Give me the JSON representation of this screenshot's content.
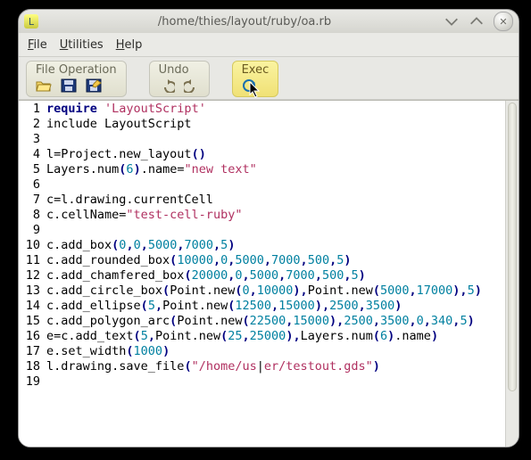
{
  "window": {
    "title": "/home/thies/layout/ruby/oa.rb"
  },
  "menu": {
    "file": "File",
    "utilities": "Utilities",
    "help": "Help"
  },
  "toolbar": {
    "fileop_label": "File Operation",
    "undo_label": "Undo",
    "exec_label": "Exec"
  },
  "code": {
    "lines": [
      {
        "n": "1",
        "segs": [
          {
            "t": "require ",
            "c": "kw"
          },
          {
            "t": "'LayoutScript'",
            "c": "str"
          }
        ]
      },
      {
        "n": "2",
        "segs": [
          {
            "t": "include LayoutScript",
            "c": "inc"
          }
        ]
      },
      {
        "n": "3",
        "segs": []
      },
      {
        "n": "4",
        "segs": [
          {
            "t": "l=Project.new_layout",
            "c": ""
          },
          {
            "t": "()",
            "c": "kw"
          }
        ]
      },
      {
        "n": "5",
        "segs": [
          {
            "t": "Layers.num",
            "c": ""
          },
          {
            "t": "(",
            "c": "kw"
          },
          {
            "t": "6",
            "c": "num"
          },
          {
            "t": ")",
            "c": "kw"
          },
          {
            "t": ".name=",
            "c": ""
          },
          {
            "t": "\"new text\"",
            "c": "str"
          }
        ]
      },
      {
        "n": "6",
        "segs": []
      },
      {
        "n": "7",
        "segs": [
          {
            "t": "c=l.drawing.currentCell",
            "c": ""
          }
        ]
      },
      {
        "n": "8",
        "segs": [
          {
            "t": "c.cellName=",
            "c": ""
          },
          {
            "t": "\"test-cell-ruby\"",
            "c": "str"
          }
        ]
      },
      {
        "n": "9",
        "segs": []
      },
      {
        "n": "10",
        "segs": [
          {
            "t": "c.add_box",
            "c": ""
          },
          {
            "t": "(",
            "c": "kw"
          },
          {
            "t": "0",
            "c": "num"
          },
          {
            "t": ",",
            "c": "kw"
          },
          {
            "t": "0",
            "c": "num"
          },
          {
            "t": ",",
            "c": "kw"
          },
          {
            "t": "5000",
            "c": "num"
          },
          {
            "t": ",",
            "c": "kw"
          },
          {
            "t": "7000",
            "c": "num"
          },
          {
            "t": ",",
            "c": "kw"
          },
          {
            "t": "5",
            "c": "num"
          },
          {
            "t": ")",
            "c": "kw"
          }
        ]
      },
      {
        "n": "11",
        "segs": [
          {
            "t": "c.add_rounded_box",
            "c": ""
          },
          {
            "t": "(",
            "c": "kw"
          },
          {
            "t": "10000",
            "c": "num"
          },
          {
            "t": ",",
            "c": "kw"
          },
          {
            "t": "0",
            "c": "num"
          },
          {
            "t": ",",
            "c": "kw"
          },
          {
            "t": "5000",
            "c": "num"
          },
          {
            "t": ",",
            "c": "kw"
          },
          {
            "t": "7000",
            "c": "num"
          },
          {
            "t": ",",
            "c": "kw"
          },
          {
            "t": "500",
            "c": "num"
          },
          {
            "t": ",",
            "c": "kw"
          },
          {
            "t": "5",
            "c": "num"
          },
          {
            "t": ")",
            "c": "kw"
          }
        ]
      },
      {
        "n": "12",
        "segs": [
          {
            "t": "c.add_chamfered_box",
            "c": ""
          },
          {
            "t": "(",
            "c": "kw"
          },
          {
            "t": "20000",
            "c": "num"
          },
          {
            "t": ",",
            "c": "kw"
          },
          {
            "t": "0",
            "c": "num"
          },
          {
            "t": ",",
            "c": "kw"
          },
          {
            "t": "5000",
            "c": "num"
          },
          {
            "t": ",",
            "c": "kw"
          },
          {
            "t": "7000",
            "c": "num"
          },
          {
            "t": ",",
            "c": "kw"
          },
          {
            "t": "500",
            "c": "num"
          },
          {
            "t": ",",
            "c": "kw"
          },
          {
            "t": "5",
            "c": "num"
          },
          {
            "t": ")",
            "c": "kw"
          }
        ]
      },
      {
        "n": "13",
        "segs": [
          {
            "t": "c.add_circle_box",
            "c": ""
          },
          {
            "t": "(",
            "c": "kw"
          },
          {
            "t": "Point.new",
            "c": ""
          },
          {
            "t": "(",
            "c": "kw"
          },
          {
            "t": "0",
            "c": "num"
          },
          {
            "t": ",",
            "c": "kw"
          },
          {
            "t": "10000",
            "c": "num"
          },
          {
            "t": ")",
            "c": "kw"
          },
          {
            "t": ",",
            "c": "kw"
          },
          {
            "t": "Point.new",
            "c": ""
          },
          {
            "t": "(",
            "c": "kw"
          },
          {
            "t": "5000",
            "c": "num"
          },
          {
            "t": ",",
            "c": "kw"
          },
          {
            "t": "17000",
            "c": "num"
          },
          {
            "t": ")",
            "c": "kw"
          },
          {
            "t": ",",
            "c": "kw"
          },
          {
            "t": "5",
            "c": "num"
          },
          {
            "t": ")",
            "c": "kw"
          }
        ]
      },
      {
        "n": "14",
        "segs": [
          {
            "t": "c.add_ellipse",
            "c": ""
          },
          {
            "t": "(",
            "c": "kw"
          },
          {
            "t": "5",
            "c": "num"
          },
          {
            "t": ",",
            "c": "kw"
          },
          {
            "t": "Point.new",
            "c": ""
          },
          {
            "t": "(",
            "c": "kw"
          },
          {
            "t": "12500",
            "c": "num"
          },
          {
            "t": ",",
            "c": "kw"
          },
          {
            "t": "15000",
            "c": "num"
          },
          {
            "t": ")",
            "c": "kw"
          },
          {
            "t": ",",
            "c": "kw"
          },
          {
            "t": "2500",
            "c": "num"
          },
          {
            "t": ",",
            "c": "kw"
          },
          {
            "t": "3500",
            "c": "num"
          },
          {
            "t": ")",
            "c": "kw"
          }
        ]
      },
      {
        "n": "15",
        "segs": [
          {
            "t": "c.add_polygon_arc",
            "c": ""
          },
          {
            "t": "(",
            "c": "kw"
          },
          {
            "t": "Point.new",
            "c": ""
          },
          {
            "t": "(",
            "c": "kw"
          },
          {
            "t": "22500",
            "c": "num"
          },
          {
            "t": ",",
            "c": "kw"
          },
          {
            "t": "15000",
            "c": "num"
          },
          {
            "t": ")",
            "c": "kw"
          },
          {
            "t": ",",
            "c": "kw"
          },
          {
            "t": "2500",
            "c": "num"
          },
          {
            "t": ",",
            "c": "kw"
          },
          {
            "t": "3500",
            "c": "num"
          },
          {
            "t": ",",
            "c": "kw"
          },
          {
            "t": "0",
            "c": "num"
          },
          {
            "t": ",",
            "c": "kw"
          },
          {
            "t": "340",
            "c": "num"
          },
          {
            "t": ",",
            "c": "kw"
          },
          {
            "t": "5",
            "c": "num"
          },
          {
            "t": ")",
            "c": "kw"
          }
        ]
      },
      {
        "n": "16",
        "segs": [
          {
            "t": "e=c.add_text",
            "c": ""
          },
          {
            "t": "(",
            "c": "kw"
          },
          {
            "t": "5",
            "c": "num"
          },
          {
            "t": ",",
            "c": "kw"
          },
          {
            "t": "Point.new",
            "c": ""
          },
          {
            "t": "(",
            "c": "kw"
          },
          {
            "t": "25",
            "c": "num"
          },
          {
            "t": ",",
            "c": "kw"
          },
          {
            "t": "25000",
            "c": "num"
          },
          {
            "t": ")",
            "c": "kw"
          },
          {
            "t": ",",
            "c": "kw"
          },
          {
            "t": "Layers.num",
            "c": ""
          },
          {
            "t": "(",
            "c": "kw"
          },
          {
            "t": "6",
            "c": "num"
          },
          {
            "t": ")",
            "c": "kw"
          },
          {
            "t": ".name",
            "c": ""
          },
          {
            "t": ")",
            "c": "kw"
          }
        ]
      },
      {
        "n": "17",
        "segs": [
          {
            "t": "e.set_width",
            "c": ""
          },
          {
            "t": "(",
            "c": "kw"
          },
          {
            "t": "1000",
            "c": "num"
          },
          {
            "t": ")",
            "c": "kw"
          }
        ]
      },
      {
        "n": "18",
        "segs": [
          {
            "t": "l.drawing.save_file",
            "c": ""
          },
          {
            "t": "(",
            "c": "kw"
          },
          {
            "t": "\"/home/us",
            "c": "str"
          },
          {
            "t": "|",
            "c": ""
          },
          {
            "t": "er/testout.gds\"",
            "c": "str"
          },
          {
            "t": ")",
            "c": "kw"
          }
        ]
      },
      {
        "n": "19",
        "segs": []
      }
    ]
  }
}
